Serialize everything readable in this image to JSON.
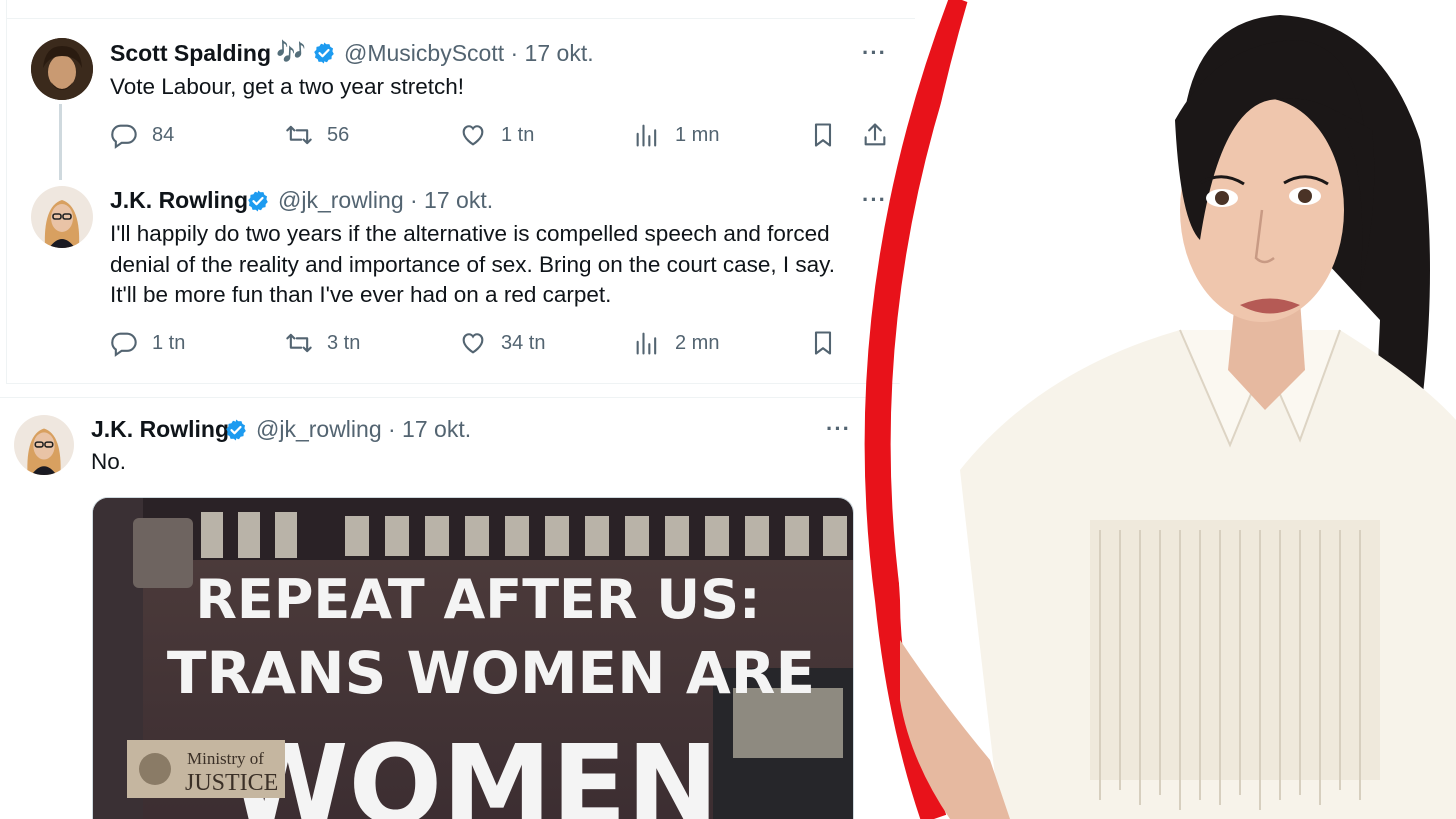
{
  "colors": {
    "accent": "#1d9bf0",
    "secondary_text": "#536471",
    "red_arc": "#e8121a"
  },
  "tweets": [
    {
      "name": "Scott Spalding",
      "emoji": "🎶",
      "handle": "@MusicbyScott · 17 okt.",
      "text": "Vote Labour, get a two year stretch!",
      "replies": "84",
      "retweets": "56",
      "likes": "1 tn",
      "views": "1 mn"
    },
    {
      "name": "J.K. Rowling",
      "handle": "@jk_rowling · 17 okt.",
      "text_lines": [
        "I'll happily do two years if the alternative is compelled speech and forced",
        "denial of the reality and importance of sex. Bring on the court case, I say.",
        "It'll be more fun than I've ever had on a red carpet."
      ],
      "replies": "1 tn",
      "retweets": "3 tn",
      "likes": "34 tn",
      "views": "2 mn"
    },
    {
      "name": "J.K. Rowling",
      "handle": "@jk_rowling · 17 okt.",
      "text": "No.",
      "media": {
        "projection_lines": [
          "REPEAT AFTER US:",
          "TRANS WOMEN ARE",
          "WOMEN"
        ],
        "sign_lines": [
          "Ministry of",
          "JUSTICE"
        ]
      }
    }
  ],
  "icons": [
    "reply-icon",
    "retweet-icon",
    "like-icon",
    "views-icon",
    "bookmark-icon",
    "share-icon",
    "verified-icon",
    "more-icon"
  ]
}
